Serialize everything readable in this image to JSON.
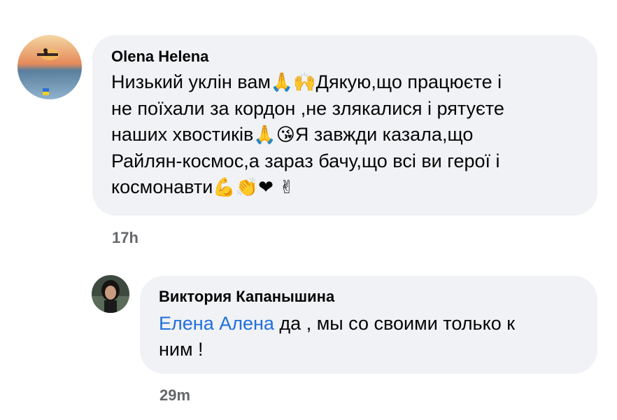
{
  "comments": [
    {
      "author": "Olena Helena",
      "text": "Низький уклін вам🙏🙌Дякую,що працюєте і не поїхали за кордон ,не злякалися і рятуєте наших хвостиків🙏😘Я завжди казала,що Райлян-космос,а зараз бачу,що всі ви герої і космонавти💪👏❤ ✌",
      "text_parts": {
        "l1a": "Низький уклін вам",
        "l1e": "🙏🙌",
        "l1b": "Дякую,що працюєте і",
        "l2": "не поїхали за кордон ,не злякалися і рятуєте",
        "l3a": "наших хвостиків",
        "l3e": "🙏😘",
        "l3b": "Я завжди казала,що",
        "l4": "Райлян-космос,а зараз бачу,що всі ви герої і",
        "l5a": "космонавти",
        "l5e": "💪👏❤ ✌"
      },
      "time": "17h",
      "avatar": "avatar-sunset-boat"
    },
    {
      "author": "Виктория Капанышина",
      "mention": "Елена Алена",
      "text_l1": " да , мы со своими только к",
      "text_l2": "ним !",
      "time": "29m",
      "avatar": "avatar-woman"
    }
  ],
  "colors": {
    "bubble": "#f0f2f5",
    "mention": "#216fdb",
    "timestamp": "#65676b"
  }
}
